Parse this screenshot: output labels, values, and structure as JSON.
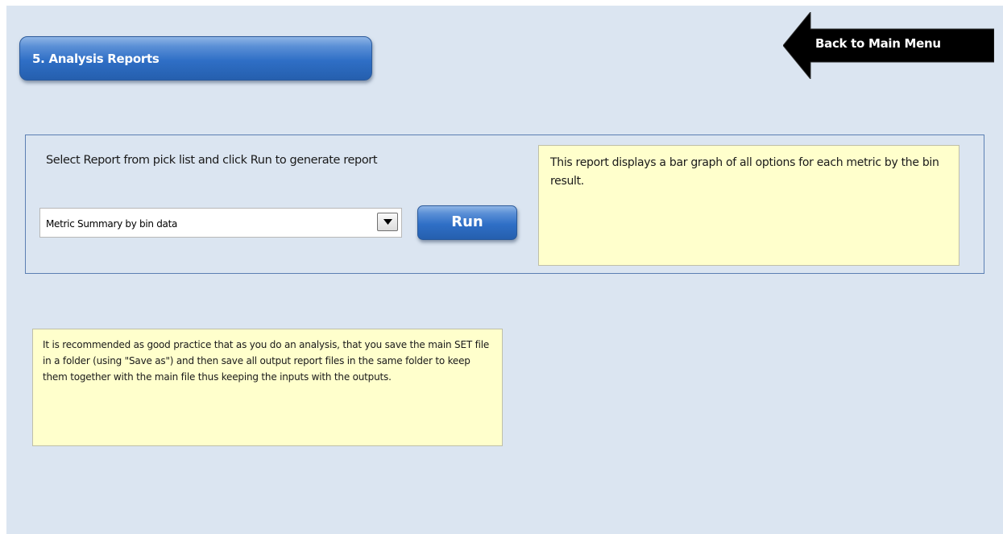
{
  "header": {
    "section_title": "5. Analysis Reports",
    "back_button_label": "Back to Main Menu"
  },
  "report_panel": {
    "instruction": "Select Report from pick list and click Run to generate report",
    "report_select": {
      "selected_value": "Metric Summary by bin data",
      "arrow_icon": "chevron-down-icon"
    },
    "run_label": "Run",
    "description": "This report displays a bar graph of all options for each metric by the bin result."
  },
  "practice_note": "It is recommended  as good practice that as you do an analysis, that you save the main SET file in a folder (using \"Save as\") and then save all output report files in the same folder to keep them together  with the main file thus keeping the  inputs with the  outputs.",
  "colors": {
    "page_background": "#dbe5f1",
    "button_blue": "#2f6fc6",
    "note_yellow": "#ffffcc",
    "back_arrow": "#000000"
  }
}
